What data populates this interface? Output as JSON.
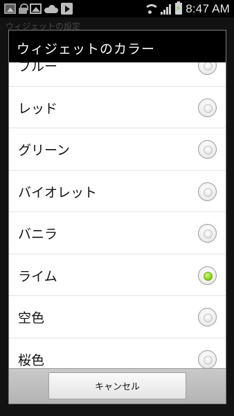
{
  "status_bar": {
    "time": "8:47 AM",
    "left_icons": [
      "image-icon",
      "lock-icon",
      "photo-icon",
      "cloud-icon",
      "play-store-icon"
    ],
    "right_icons": [
      "wifi-icon",
      "signal-icon",
      "battery-charging-icon"
    ]
  },
  "background": {
    "title": "ウィジェットの設定"
  },
  "dialog": {
    "title": "ウィジェットのカラー",
    "options": [
      {
        "label": "ブルー",
        "selected": false
      },
      {
        "label": "レッド",
        "selected": false
      },
      {
        "label": "グリーン",
        "selected": false
      },
      {
        "label": "バイオレット",
        "selected": false
      },
      {
        "label": "バニラ",
        "selected": false
      },
      {
        "label": "ライム",
        "selected": true
      },
      {
        "label": "空色",
        "selected": false
      },
      {
        "label": "桜色",
        "selected": false
      }
    ],
    "cancel_label": "キャンセル",
    "accent_color": "#8fd51f"
  }
}
